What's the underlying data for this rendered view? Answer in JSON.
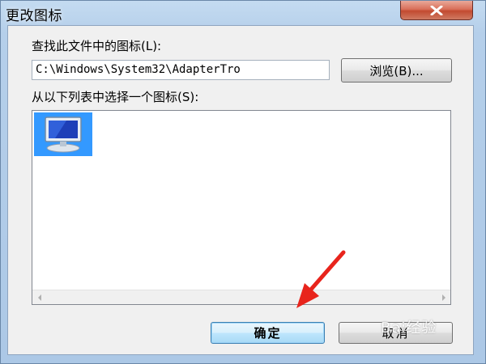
{
  "window": {
    "title": "更改图标",
    "close_symbol": "x"
  },
  "file_section": {
    "label": "查找此文件中的图标(L):",
    "path_value": "C:\\Windows\\System32\\AdapterTro",
    "browse_label": "浏览(B)..."
  },
  "icon_section": {
    "label": "从以下列表中选择一个图标(S):",
    "icons": [
      {
        "icon": "monitor-network-icon",
        "selected": true
      }
    ]
  },
  "buttons": {
    "ok_label": "确定",
    "cancel_label": "取消"
  },
  "annotation": {
    "type": "red-arrow",
    "target": "ok-button",
    "color": "#e8241c"
  },
  "watermark": {
    "text": "Bai经验"
  },
  "colors": {
    "selection": "#3399ff",
    "close_button": "#c8523a",
    "default_button_border": "#3c7fb1"
  }
}
